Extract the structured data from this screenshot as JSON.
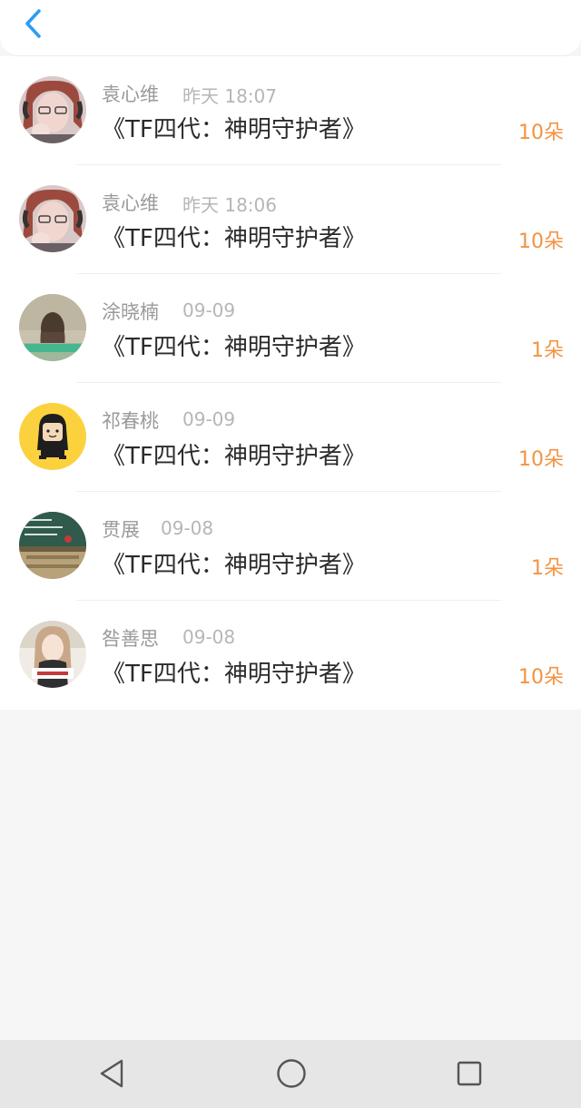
{
  "header": {
    "back_icon": "chevron-left-icon",
    "accent_color": "#2a9df4"
  },
  "records": [
    {
      "name": "袁心维",
      "time": "昨天 18:07",
      "title": "《TF四代：神明守护者》",
      "amount": "10朵",
      "avatar": "photo-girl-red-hair"
    },
    {
      "name": "袁心维",
      "time": "昨天 18:06",
      "title": "《TF四代：神明守护者》",
      "amount": "10朵",
      "avatar": "photo-girl-red-hair"
    },
    {
      "name": "涂晓楠",
      "time": "09-09",
      "title": "《TF四代：神明守护者》",
      "amount": "1朵",
      "avatar": "photo-girl-back"
    },
    {
      "name": "祁春桃",
      "time": "09-09",
      "title": "《TF四代：神明守护者》",
      "amount": "10朵",
      "avatar": "cartoon-girl-yellow"
    },
    {
      "name": "贯展",
      "time": "09-08",
      "title": "《TF四代：神明守护者》",
      "amount": "1朵",
      "avatar": "photo-classroom"
    },
    {
      "name": "咎善思",
      "time": "09-08",
      "title": "《TF四代：神明守护者》",
      "amount": "10朵",
      "avatar": "photo-girl-long-hair"
    }
  ],
  "colors": {
    "amount": "#f39341",
    "name": "#9a9a9a",
    "time": "#b6b6b6",
    "title": "#2b2b2b"
  },
  "navbar": {
    "back_icon": "triangle-back-icon",
    "home_icon": "circle-home-icon",
    "recents_icon": "square-recents-icon"
  }
}
